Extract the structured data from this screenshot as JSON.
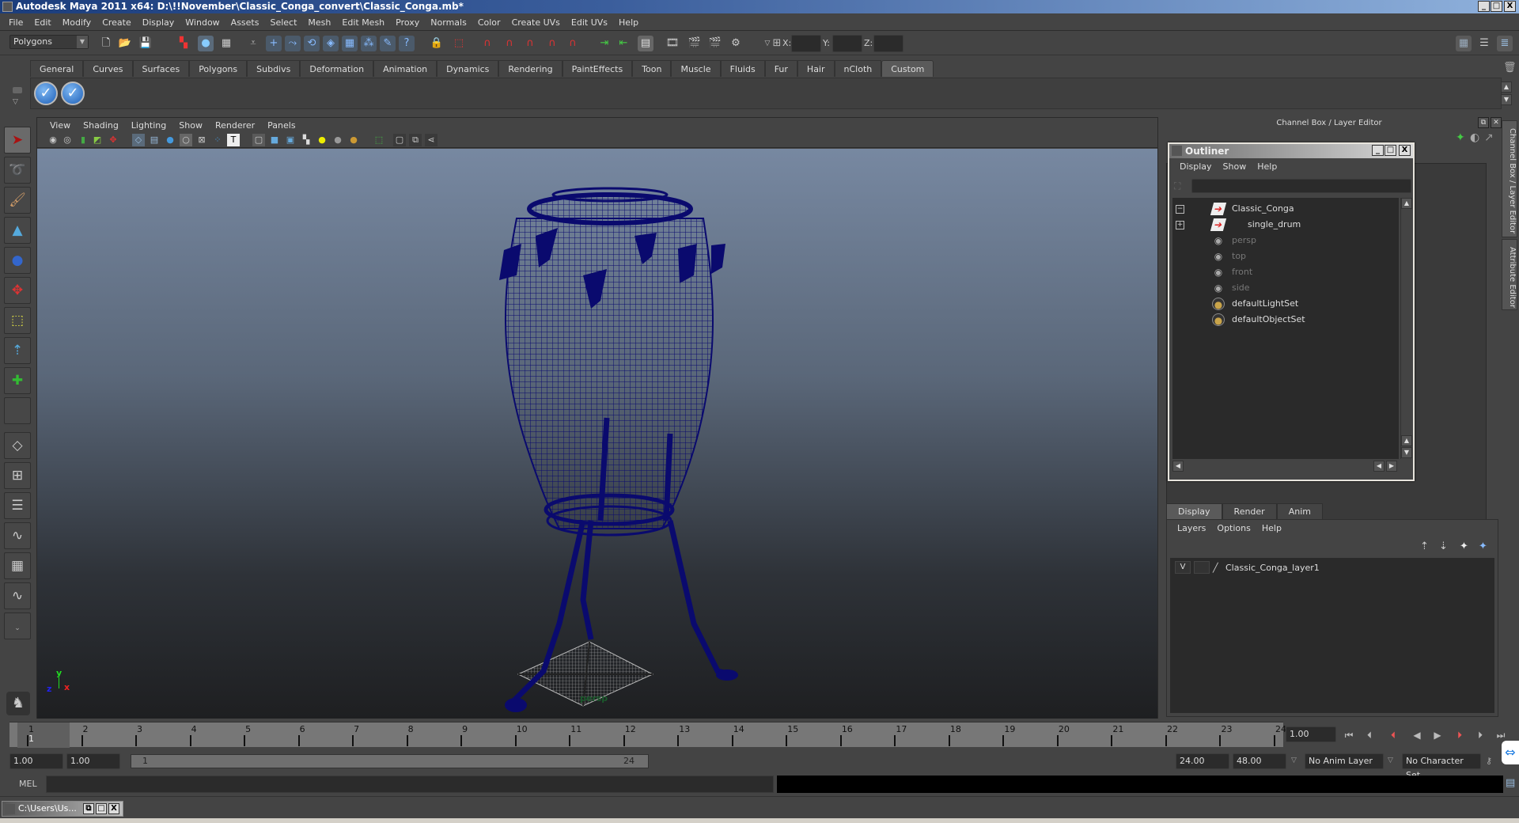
{
  "window": {
    "title": "Autodesk Maya 2011 x64: D:\\!!November\\Classic_Conga_convert\\Classic_Conga.mb*",
    "minimize": "_",
    "maximize": "□",
    "close": "X"
  },
  "menubar": [
    "File",
    "Edit",
    "Modify",
    "Create",
    "Display",
    "Window",
    "Assets",
    "Select",
    "Mesh",
    "Edit Mesh",
    "Proxy",
    "Normals",
    "Color",
    "Create UVs",
    "Edit UVs",
    "Help"
  ],
  "statusline": {
    "menu_set": "Polygons",
    "x_label": "X:",
    "y_label": "Y:",
    "z_label": "Z:",
    "x_value": "",
    "y_value": "",
    "z_value": ""
  },
  "shelf": {
    "tabs": [
      "General",
      "Curves",
      "Surfaces",
      "Polygons",
      "Subdivs",
      "Deformation",
      "Animation",
      "Dynamics",
      "Rendering",
      "PaintEffects",
      "Toon",
      "Muscle",
      "Fluids",
      "Fur",
      "Hair",
      "nCloth",
      "Custom"
    ],
    "active_tab": "Custom",
    "buttons": [
      "check-icon",
      "check-icon"
    ]
  },
  "toolbox": {
    "tools": [
      "select-tool",
      "lasso-tool",
      "paint-select-tool",
      "move-tool",
      "rotate-tool",
      "scale-tool",
      "universal-manipulator",
      "soft-mod-tool",
      "show-manipulator",
      "last-used-tool"
    ],
    "layouts": [
      "single-perspective-layout",
      "four-view-layout",
      "outliner-persp-layout",
      "persp-graph-layout",
      "hypershade-persp-layout",
      "persp-graph-hypergraph-layout",
      "more-layouts"
    ]
  },
  "viewport": {
    "menu": [
      "View",
      "Shading",
      "Lighting",
      "Show",
      "Renderer",
      "Panels"
    ],
    "camera_label": "persp",
    "axis": {
      "x": "x",
      "y": "y",
      "z": "z"
    },
    "wire_color": "#0a0a6e"
  },
  "channel_box": {
    "title": "Channel Box / Layer Editor"
  },
  "side_tabs": [
    "Channel Box / Layer Editor",
    "Attribute Editor"
  ],
  "outliner": {
    "title": "Outliner",
    "menu": [
      "Display",
      "Show",
      "Help"
    ],
    "search_value": "",
    "items": [
      {
        "label": "Classic_Conga",
        "type": "transform",
        "expand": "−",
        "dim": false
      },
      {
        "label": "single_drum",
        "type": "transform",
        "expand": "+",
        "dim": false
      },
      {
        "label": "persp",
        "type": "camera",
        "dim": true
      },
      {
        "label": "top",
        "type": "camera",
        "dim": true
      },
      {
        "label": "front",
        "type": "camera",
        "dim": true
      },
      {
        "label": "side",
        "type": "camera",
        "dim": true
      },
      {
        "label": "defaultLightSet",
        "type": "set",
        "dim": false
      },
      {
        "label": "defaultObjectSet",
        "type": "set",
        "dim": false
      }
    ]
  },
  "layer_editor": {
    "tabs": [
      "Display",
      "Render",
      "Anim"
    ],
    "active_tab": "Display",
    "menu": [
      "Layers",
      "Options",
      "Help"
    ],
    "layers": [
      {
        "visible": "V",
        "template": "",
        "name": "Classic_Conga_layer1"
      }
    ]
  },
  "time_slider": {
    "start": 1,
    "end": 24,
    "current": 1,
    "ticks": [
      "1",
      "2",
      "3",
      "4",
      "5",
      "6",
      "7",
      "8",
      "9",
      "10",
      "11",
      "12",
      "13",
      "14",
      "15",
      "16",
      "17",
      "18",
      "19",
      "20",
      "21",
      "22",
      "23",
      "24"
    ],
    "current_frame_field": "1.00"
  },
  "range_slider": {
    "anim_start": "1.00",
    "playback_start": "1.00",
    "range_start_label": "1",
    "range_end_label": "24",
    "playback_end": "24.00",
    "anim_end": "48.00",
    "anim_layer": "No Anim Layer",
    "character_set": "No Character Set"
  },
  "command_line": {
    "label": "MEL",
    "input": "",
    "output": ""
  },
  "taskbar": {
    "item": "C:\\Users\\Us..."
  }
}
